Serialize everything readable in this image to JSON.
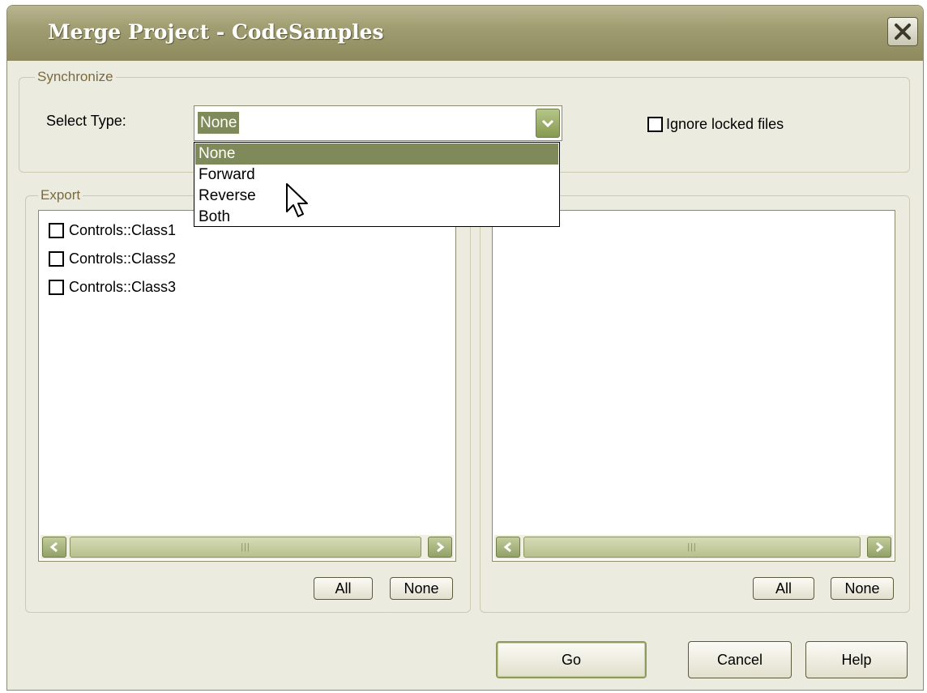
{
  "window": {
    "title": "Merge Project - CodeSamples"
  },
  "synchronize": {
    "legend": "Synchronize",
    "select_type_label": "Select Type:",
    "select_type_value": "None",
    "options": [
      "None",
      "Forward",
      "Reverse",
      "Both"
    ],
    "selected_option": "None",
    "ignore_locked_label": "Ignore locked files",
    "ignore_locked_checked": false
  },
  "export": {
    "legend": "Export",
    "items": [
      {
        "label": "Controls::Class1",
        "checked": false
      },
      {
        "label": "Controls::Class2",
        "checked": false
      },
      {
        "label": "Controls::Class3",
        "checked": false
      }
    ],
    "all_label": "All",
    "none_label": "None"
  },
  "import": {
    "items": [],
    "all_label": "All",
    "none_label": "None"
  },
  "buttons": {
    "go": "Go",
    "cancel": "Cancel",
    "help": "Help"
  },
  "colors": {
    "title_bar": "#a09d72",
    "selection": "#7f8a5a",
    "dialog_bg": "#ecebe0",
    "legend_text": "#7a6a3c"
  },
  "icons": {
    "close": "close-icon",
    "dropdown": "chevron-down-icon",
    "scroll_left": "arrow-left-icon",
    "scroll_right": "arrow-right-icon",
    "cursor": "mouse-pointer-icon"
  }
}
